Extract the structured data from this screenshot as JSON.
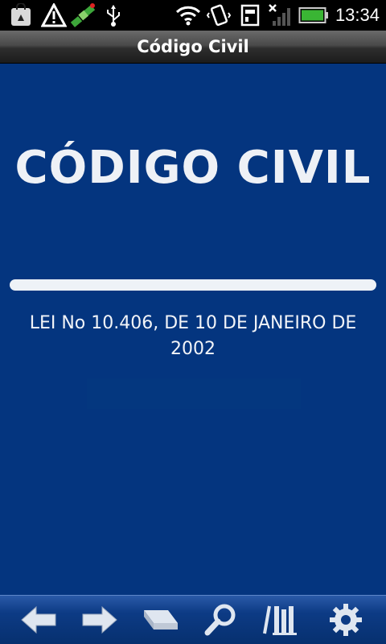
{
  "status_bar": {
    "time": "13:34"
  },
  "title_bar": {
    "title": "Código Civil"
  },
  "content": {
    "heading": "CÓDIGO CIVIL",
    "law_text": "LEI No 10.406, DE 10 DE JANEIRO DE 2002"
  },
  "toolbar": {
    "buttons": [
      {
        "icon": "arrow-left-icon"
      },
      {
        "icon": "arrow-right-icon"
      },
      {
        "icon": "book-icon"
      },
      {
        "icon": "search-icon"
      },
      {
        "icon": "library-icon"
      },
      {
        "icon": "gear-icon"
      }
    ]
  },
  "colors": {
    "background": "#04357f",
    "toolbar": "#0d3b85",
    "text": "#eef1f6"
  }
}
